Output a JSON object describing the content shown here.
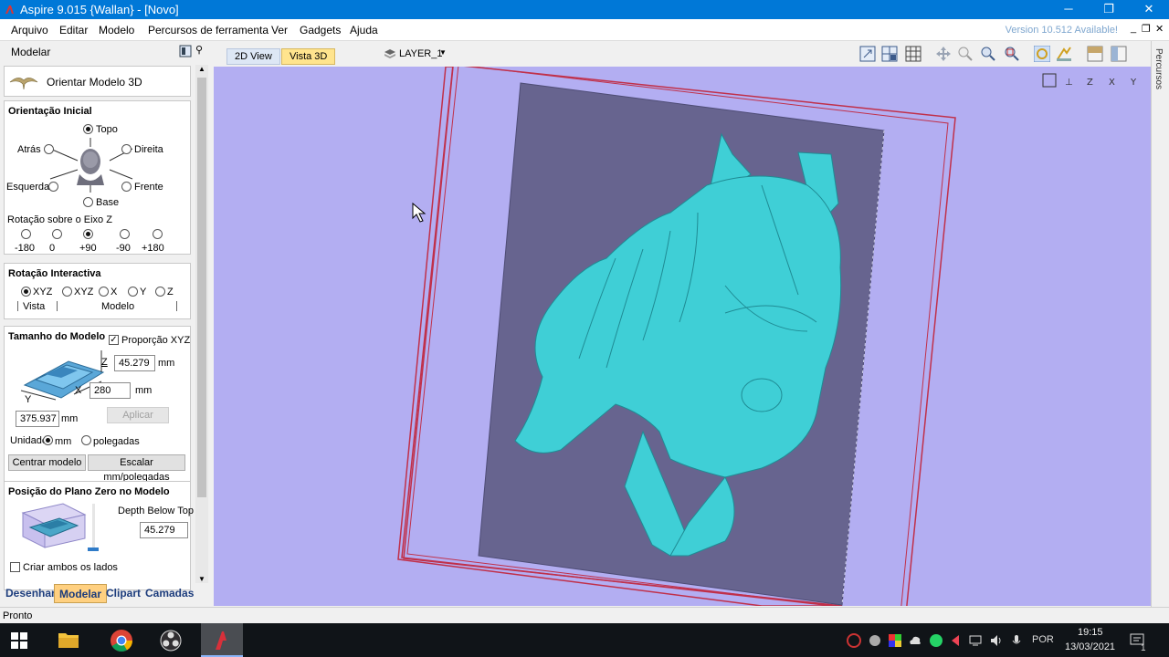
{
  "window": {
    "title": "Aspire 9.015 {Wallan} - [Novo]",
    "controls": {
      "minimize": "─",
      "maximize": "❐",
      "close": "✕"
    }
  },
  "menu": {
    "items": [
      "Arquivo",
      "Editar",
      "Modelo",
      "Percursos de ferramenta",
      "Ver",
      "Gadgets",
      "Ajuda"
    ],
    "version_notice": "Version 10.512 Available!",
    "mdi_controls": [
      "_",
      "❐",
      "✕"
    ]
  },
  "left_panel": {
    "header": "Modelar",
    "tool_title": "Orientar Modelo 3D",
    "orientation": {
      "title": "Orientação Inicial",
      "options": {
        "top": "Topo",
        "back": "Atrás",
        "right": "Direita",
        "left": "Esquerda",
        "front": "Frente",
        "base": "Base"
      },
      "selected": "Topo",
      "z_rotation_label": "Rotação sobre o Eixo Z",
      "z_rotation_options": [
        "-180",
        "0",
        "+90",
        "-90",
        "+180"
      ],
      "z_rotation_selected": "+90"
    },
    "interactive_rotation": {
      "title": "Rotação Interactiva",
      "options": [
        "XYZ",
        "XYZ",
        "X",
        "Y",
        "Z"
      ],
      "selected_index": 0,
      "group_view": "Vista",
      "group_model": "Modelo"
    },
    "model_size": {
      "title": "Tamanho do Modelo",
      "proportion_label": "Proporção XYZ",
      "proportion_checked": true,
      "z_label": "Z",
      "z_value": "45.279",
      "x_label": "X",
      "x_value": "280",
      "y_label": "Y",
      "y_value": "375.937",
      "unit_mm": "mm",
      "apply_label": "Aplicar",
      "unit_label": "Unidade",
      "unit_opt_mm": "mm",
      "unit_opt_in": "polegadas",
      "unit_selected": "mm",
      "center_button": "Centrar modelo",
      "scale_button": "Escalar mm/polegadas"
    },
    "zero_plane": {
      "title": "Posição do Plano Zero no Modelo",
      "depth_label": "Depth Below Top",
      "depth_value": "45.279",
      "both_sides_label": "Criar ambos os lados"
    },
    "bottom_tabs": [
      "Desenhar",
      "Modelar",
      "Clipart",
      "Camadas"
    ],
    "active_tab": "Modelar"
  },
  "view": {
    "tabs": [
      "2D View",
      "Vista 3D"
    ],
    "active_tab": "Vista 3D",
    "layer": "LAYER_1",
    "right_strip_label": "Percursos",
    "colors": {
      "background": "#b3aef2",
      "relief": "#3fcfd6",
      "plate": "#67648f",
      "frame": "#c0304a"
    }
  },
  "status": {
    "text": "Pronto"
  },
  "taskbar": {
    "language": "POR",
    "time": "19:15",
    "date": "13/03/2021",
    "notifications": "1"
  }
}
